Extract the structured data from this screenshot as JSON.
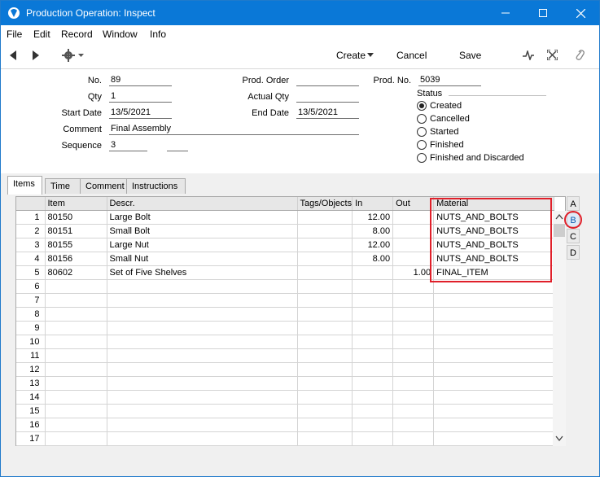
{
  "window": {
    "title": "Production Operation: Inspect"
  },
  "menu": [
    "File",
    "Edit",
    "Record",
    "Window",
    "Info"
  ],
  "toolbar": {
    "create": "Create",
    "cancel": "Cancel",
    "save": "Save"
  },
  "form": {
    "no_label": "No.",
    "no_value": "89",
    "qty_label": "Qty",
    "qty_value": "1",
    "start_label": "Start Date",
    "start_value": "13/5/2021",
    "comment_label": "Comment",
    "comment_value": "Final Assembly",
    "sequence_label": "Sequence",
    "sequence_value": "3",
    "prodorder_label": "Prod. Order",
    "prodorder_value": "",
    "actualqty_label": "Actual Qty",
    "actualqty_value": "",
    "end_label": "End Date",
    "end_value": "13/5/2021",
    "prodno_label": "Prod. No.",
    "prodno_value": "5039",
    "status_label": "Status",
    "status_options": [
      "Created",
      "Cancelled",
      "Started",
      "Finished",
      "Finished and Discarded"
    ],
    "status_selected": "Created"
  },
  "tabs": [
    "Items",
    "Time",
    "Comment",
    "Instructions"
  ],
  "active_tab": "Items",
  "grid": {
    "columns": [
      "Item",
      "Descr.",
      "Tags/Objects",
      "In",
      "Out",
      "Material"
    ],
    "rows": [
      [
        "80150",
        "Large Bolt",
        "",
        "12.00",
        "",
        "NUTS_AND_BOLTS"
      ],
      [
        "80151",
        "Small Bolt",
        "",
        "8.00",
        "",
        "NUTS_AND_BOLTS"
      ],
      [
        "80155",
        "Large Nut",
        "",
        "12.00",
        "",
        "NUTS_AND_BOLTS"
      ],
      [
        "80156",
        "Small Nut",
        "",
        "8.00",
        "",
        "NUTS_AND_BOLTS"
      ],
      [
        "80602",
        "Set of Five Shelves",
        "",
        "",
        "1.00",
        "FINAL_ITEM"
      ]
    ],
    "row_numbers": [
      "1",
      "2",
      "3",
      "4",
      "5",
      "6",
      "7",
      "8",
      "9",
      "10",
      "11",
      "12",
      "13",
      "14",
      "15",
      "16",
      "17"
    ]
  },
  "side_tabs": [
    "A",
    "B",
    "C",
    "D"
  ],
  "colors": {
    "titlebar": "#0a78d7",
    "highlight": "#e0202a"
  }
}
